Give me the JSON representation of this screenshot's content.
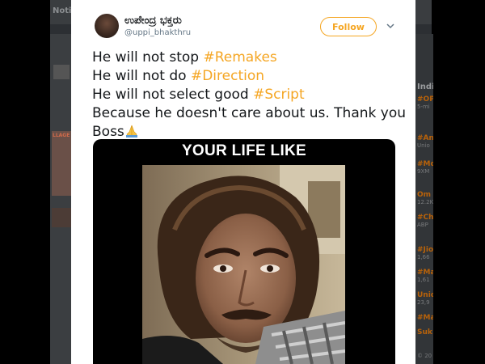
{
  "background": {
    "topbar": {
      "notifications": "Notif",
      "right_text": "Se"
    },
    "sidebar_right": {
      "title": "Indi",
      "trends": [
        {
          "tag": "#OP",
          "sub": "5-mi"
        },
        {
          "tag": "#An",
          "sub": "Unio"
        },
        {
          "tag": "#Mo",
          "sub": "9XM"
        },
        {
          "tag": "Om",
          "sub": "12.2K"
        },
        {
          "tag": "#Ch",
          "sub": "ABP"
        },
        {
          "tag": "#Jio",
          "sub": "1,66"
        },
        {
          "tag": "#Ma",
          "sub": "1,61"
        },
        {
          "tag": "Unio",
          "sub": "23,9"
        },
        {
          "tag": "#Ma",
          "sub": ""
        },
        {
          "tag": "Suk",
          "sub": ""
        }
      ],
      "footer": "© 20"
    },
    "sidebar_left": {
      "label": "LLAGE"
    }
  },
  "tweet": {
    "display_name": "ಉಪೇಂದ್ರ ಭಕ್ತರು",
    "handle": "@uppi_bhakthru",
    "follow_label": "Follow",
    "lines": [
      {
        "text": "He will not stop ",
        "hashtag": "#Remakes"
      },
      {
        "text": "He will not do ",
        "hashtag": "#Direction"
      },
      {
        "text": "He will not select good ",
        "hashtag": "#Script"
      },
      {
        "text": "Because he doesn't care about us. Thank you",
        "hashtag": ""
      },
      {
        "text": "Boss",
        "hashtag": ""
      }
    ],
    "media": {
      "caption": "YOUR LIFE LIKE"
    },
    "colors": {
      "accent": "#f5a623",
      "text": "#14171a",
      "muted": "#657786"
    }
  }
}
